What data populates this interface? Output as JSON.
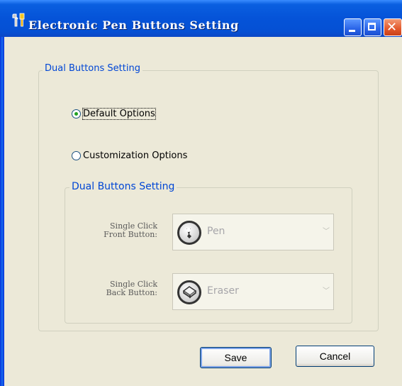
{
  "window": {
    "title": "Electronic Pen Buttons Setting",
    "icon": "tools-icon",
    "controls": [
      "minimize-icon",
      "maximize-icon",
      "close-icon"
    ],
    "close_glyph": "✕"
  },
  "dual_buttons": {
    "group_label": "Dual Buttons Setting",
    "options": [
      {
        "label": "Default Options",
        "checked": true
      },
      {
        "label": "Customization Options",
        "checked": false
      }
    ],
    "inner_group_label": "Dual Buttons Setting",
    "front": {
      "label_line1": "Single Click",
      "label_line2": "Front Button:",
      "value": "Pen",
      "icon": "pen-icon",
      "enabled": false
    },
    "back": {
      "label_line1": "Single Click",
      "label_line2": "Back Button:",
      "value": "Eraser",
      "icon": "eraser-icon",
      "enabled": false
    }
  },
  "buttons": {
    "save_label": "Save",
    "cancel_label": "Cancel"
  },
  "colors": {
    "title_bar": "#0553d8",
    "dialog_bg": "#ece9d8",
    "group_label": "#0046d5",
    "disabled_text": "#a7a6aa"
  }
}
